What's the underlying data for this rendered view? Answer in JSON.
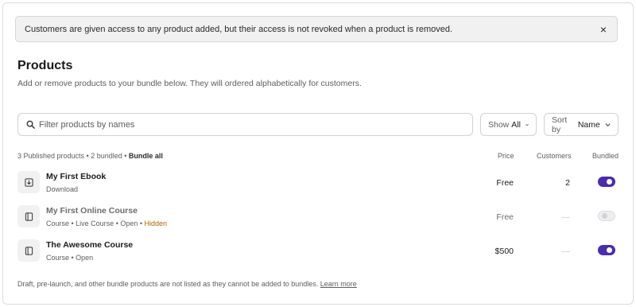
{
  "banner": {
    "text": "Customers are given access to any product added, but their access is not revoked when a product is removed.",
    "close_icon": "×"
  },
  "section": {
    "title": "Products",
    "subtitle": "Add or remove products to your bundle below. They will ordered alphabetically for customers."
  },
  "filters": {
    "search_placeholder": "Filter products by names",
    "show_label": "Show",
    "show_value": "All",
    "sort_label": "Sort by",
    "sort_value": "Name"
  },
  "summary": {
    "text": "3 Published products • 2 bundled •",
    "bundle_all": "Bundle all"
  },
  "columns": {
    "price": "Price",
    "customers": "Customers",
    "bundled": "Bundled"
  },
  "products": [
    {
      "name": "My First Ebook",
      "sub": "Download",
      "hidden_tag": "",
      "price": "Free",
      "customers": "2",
      "bundled": true,
      "icon": "download-icon"
    },
    {
      "name": "My First Online Course",
      "sub": "Course • Live Course • Open •",
      "hidden_tag": "Hidden",
      "price": "Free",
      "customers": "—",
      "bundled": false,
      "icon": "course-icon"
    },
    {
      "name": "The Awesome Course",
      "sub": "Course • Open",
      "hidden_tag": "",
      "price": "$500",
      "customers": "—",
      "bundled": true,
      "icon": "course-icon"
    }
  ],
  "footer": {
    "text": "Draft, pre-launch, and other bundle products are not listed as they cannot be added to bundles.",
    "link": "Learn more"
  },
  "colors": {
    "accent": "#4a2bb3",
    "hidden_tag": "#b45f06"
  }
}
